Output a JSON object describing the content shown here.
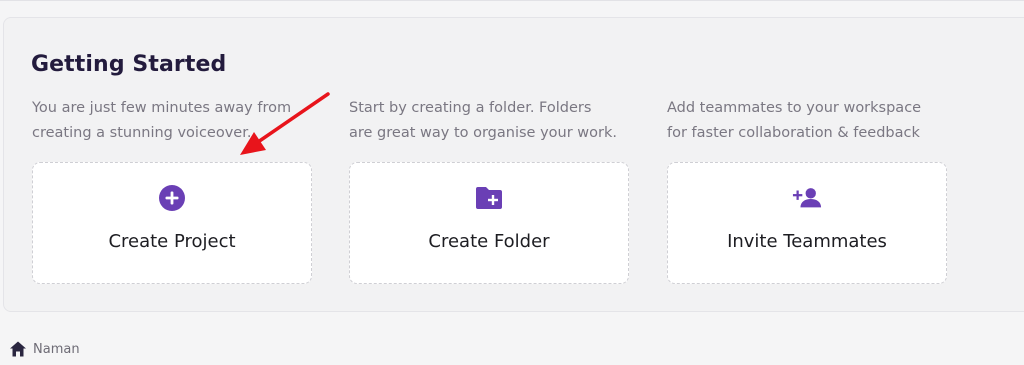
{
  "section": {
    "title": "Getting Started"
  },
  "columns": [
    {
      "desc_line1": "You are just few minutes away from",
      "desc_line2": "creating a stunning voiceover.",
      "card_label": "Create Project",
      "icon": "add-circle-icon"
    },
    {
      "desc_line1": "Start by creating a folder. Folders",
      "desc_line2": "are great way to organise your work.",
      "card_label": "Create Folder",
      "icon": "folder-add-icon"
    },
    {
      "desc_line1": "Add teammates to your workspace",
      "desc_line2": "for faster collaboration & feedback",
      "card_label": "Invite Teammates",
      "icon": "person-add-icon"
    }
  ],
  "footer": {
    "workspace_name": "Naman",
    "icon": "home-icon"
  },
  "colors": {
    "accent": "#6a3fb5",
    "annotation_arrow": "#e8141b"
  }
}
